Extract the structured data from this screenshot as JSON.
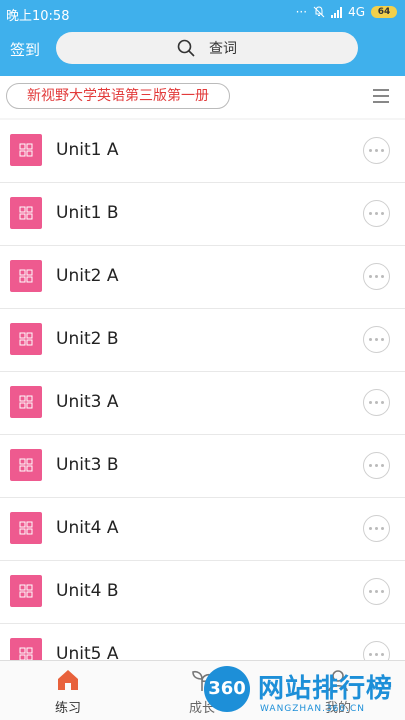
{
  "status": {
    "time": "晚上10:58",
    "dots": "···",
    "network": "4G",
    "battery": "64"
  },
  "header": {
    "checkin_label": "签到",
    "search_label": "查词"
  },
  "book": {
    "title": "新视野大学英语第三版第一册"
  },
  "units": [
    {
      "label": "Unit1 A"
    },
    {
      "label": "Unit1 B"
    },
    {
      "label": "Unit2 A"
    },
    {
      "label": "Unit2 B"
    },
    {
      "label": "Unit3 A"
    },
    {
      "label": "Unit3 B"
    },
    {
      "label": "Unit4 A"
    },
    {
      "label": "Unit4 B"
    },
    {
      "label": "Unit5 A"
    }
  ],
  "tabs": [
    {
      "label": "练习"
    },
    {
      "label": "成长"
    },
    {
      "label": "我的"
    }
  ],
  "watermark": {
    "logo": "360",
    "text": "网站排行榜",
    "sub": "WANGZHAN.360.CN"
  },
  "colors": {
    "header": "#3fb0ec",
    "unit_thumb": "#ee5a8f",
    "book_title": "#e23b3b",
    "tab_active": "#e8613b"
  }
}
